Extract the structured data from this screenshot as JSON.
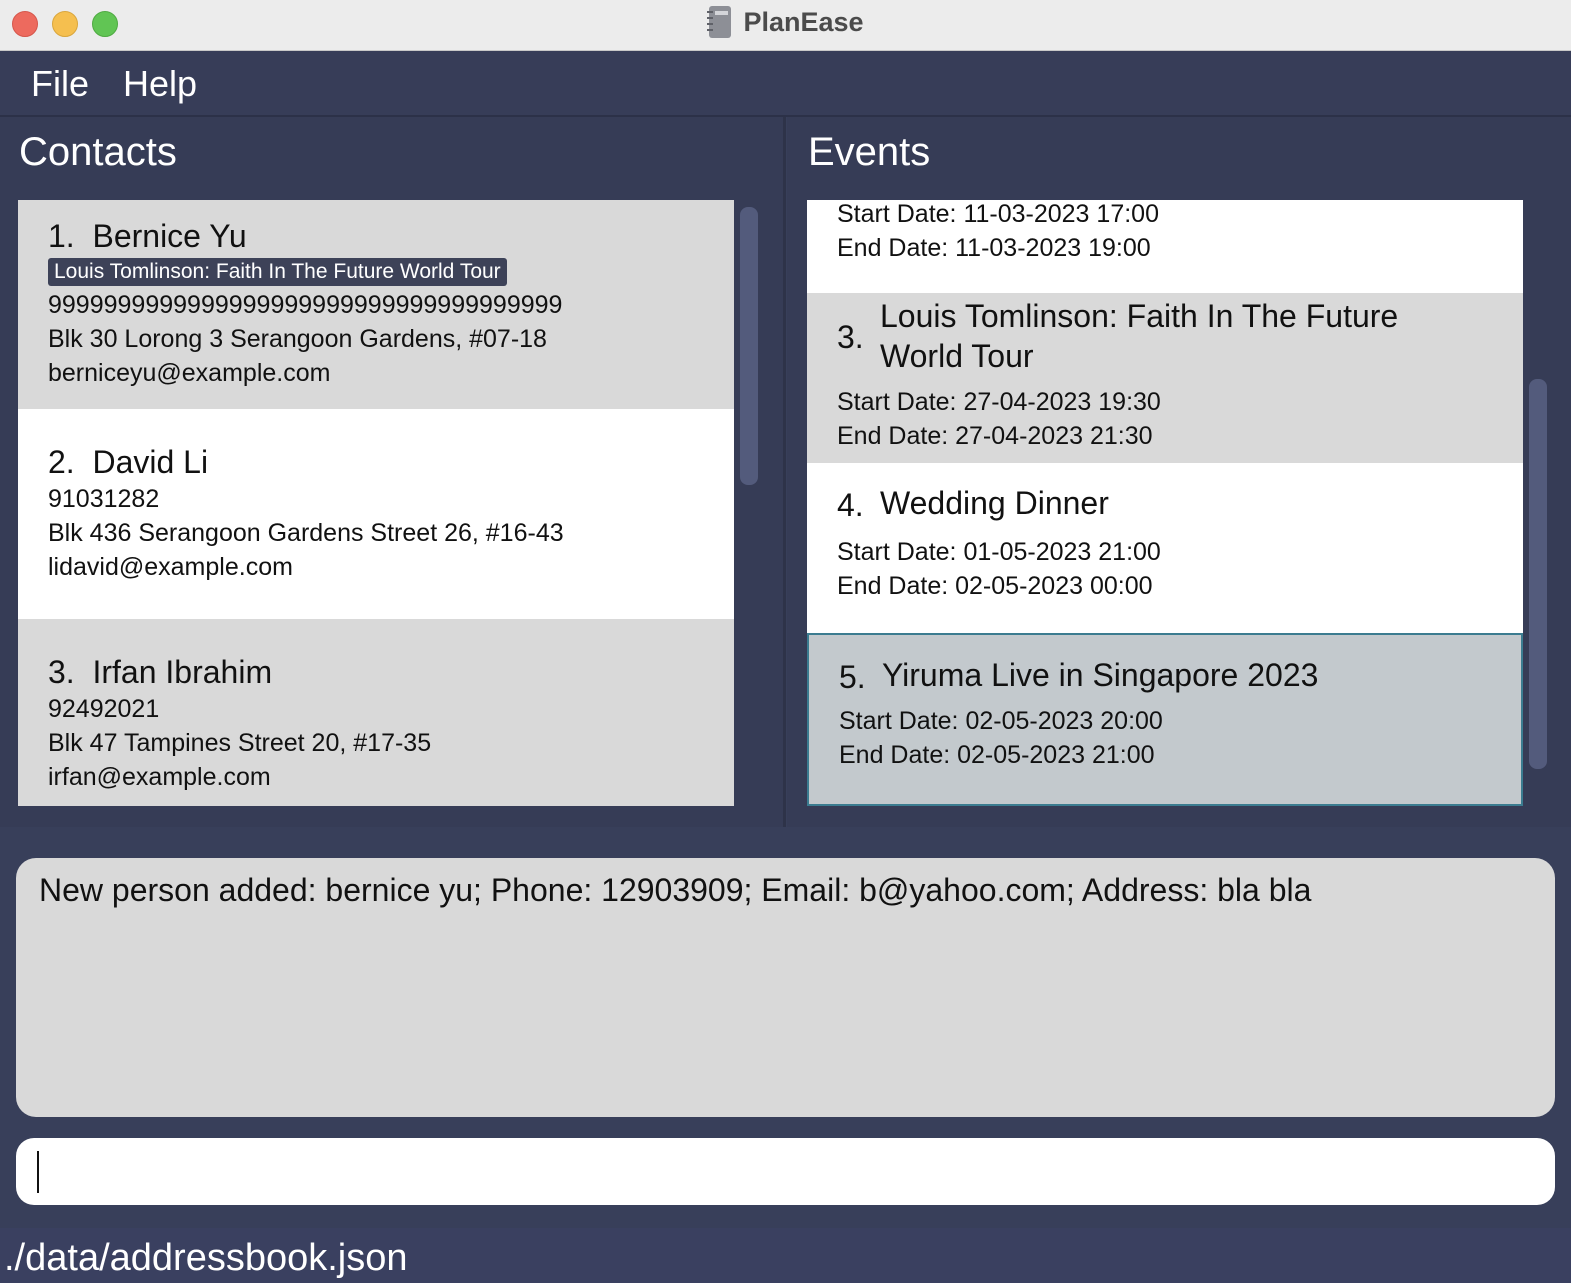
{
  "window": {
    "title": "PlanEase",
    "icon": "notebook-icon"
  },
  "menu": [
    {
      "label": "File"
    },
    {
      "label": "Help"
    }
  ],
  "contacts": {
    "title": "Contacts",
    "items": [
      {
        "index": "1.",
        "name": "Bernice Yu",
        "tag": "Louis Tomlinson: Faith In The Future World Tour",
        "phone": "9999999999999999999999999999999999999",
        "address": "Blk 30 Lorong 3 Serangoon Gardens, #07-18",
        "email": "berniceyu@example.com"
      },
      {
        "index": "2.",
        "name": "David Li",
        "phone": "91031282",
        "address": "Blk 436 Serangoon Gardens Street 26, #16-43",
        "email": "lidavid@example.com"
      },
      {
        "index": "3.",
        "name": "Irfan Ibrahim",
        "phone": "92492021",
        "address": "Blk 47 Tampines Street 20, #17-35",
        "email": "irfan@example.com"
      }
    ]
  },
  "events": {
    "title": "Events",
    "items": [
      {
        "start": "Start Date: 11-03-2023 17:00",
        "end": "End Date: 11-03-2023 19:00"
      },
      {
        "index": "3.",
        "name": "Louis Tomlinson: Faith In The Future World Tour",
        "start": "Start Date: 27-04-2023 19:30",
        "end": "End Date: 27-04-2023 21:30"
      },
      {
        "index": "4.",
        "name": "Wedding Dinner",
        "start": "Start Date: 01-05-2023 21:00",
        "end": "End Date: 02-05-2023 00:00"
      },
      {
        "index": "5.",
        "name": "Yiruma Live in Singapore 2023",
        "start": "Start Date: 02-05-2023 20:00",
        "end": "End Date: 02-05-2023 21:00"
      }
    ]
  },
  "result": {
    "text": "New person added: bernice yu; Phone: 12903909; Email: b@yahoo.com; Address: bla bla"
  },
  "command": {
    "value": "",
    "placeholder": ""
  },
  "status": {
    "path": "./data/addressbook.json"
  }
}
